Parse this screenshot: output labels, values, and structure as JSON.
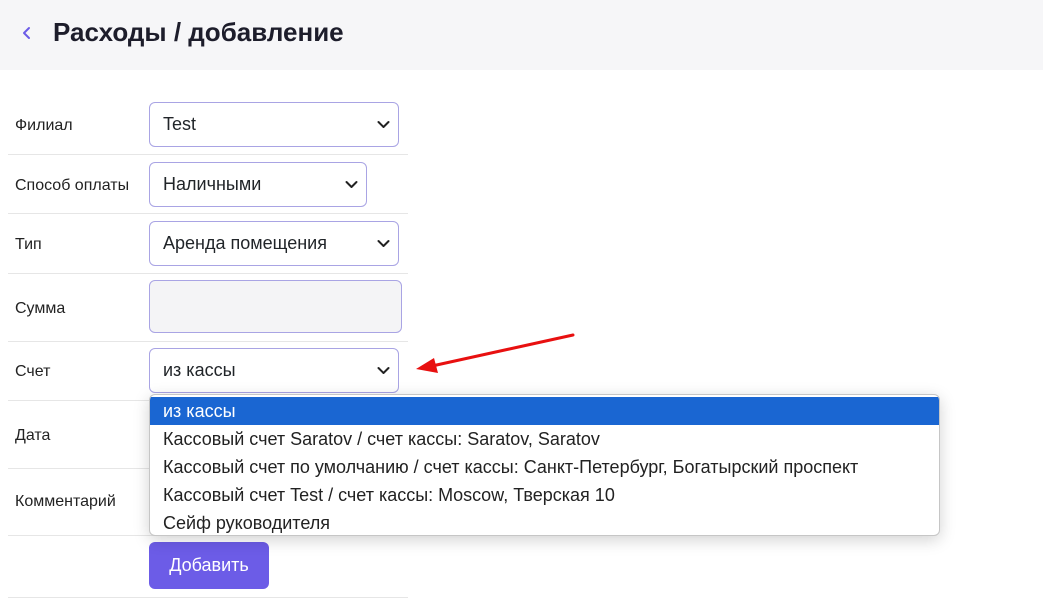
{
  "header": {
    "title": "Расходы / добавление",
    "back_icon": "chevron-left-icon",
    "accent_color": "#6c5ce7"
  },
  "form": {
    "branch": {
      "label": "Филиал",
      "value": "Test"
    },
    "payment_method": {
      "label": "Способ оплаты",
      "value": "Наличными"
    },
    "type": {
      "label": "Тип",
      "value": "Аренда помещения"
    },
    "amount": {
      "label": "Сумма",
      "value": ""
    },
    "account": {
      "label": "Счет",
      "value": "из кассы",
      "options": [
        "из кассы",
        "Кассовый счет Saratov / счет кассы: Saratov, Saratov",
        "Кассовый счет по умолчанию / счет кассы: Санкт-Петербург, Богатырский проспект",
        "Кассовый счет Test / счет кассы: Moscow, Тверская 10",
        "Сейф руководителя"
      ],
      "selected_index": 0
    },
    "date": {
      "label": "Дата"
    },
    "comment": {
      "label": "Комментарий"
    },
    "submit_label": "Добавить"
  },
  "annotation": {
    "arrow_color": "#e81010"
  }
}
